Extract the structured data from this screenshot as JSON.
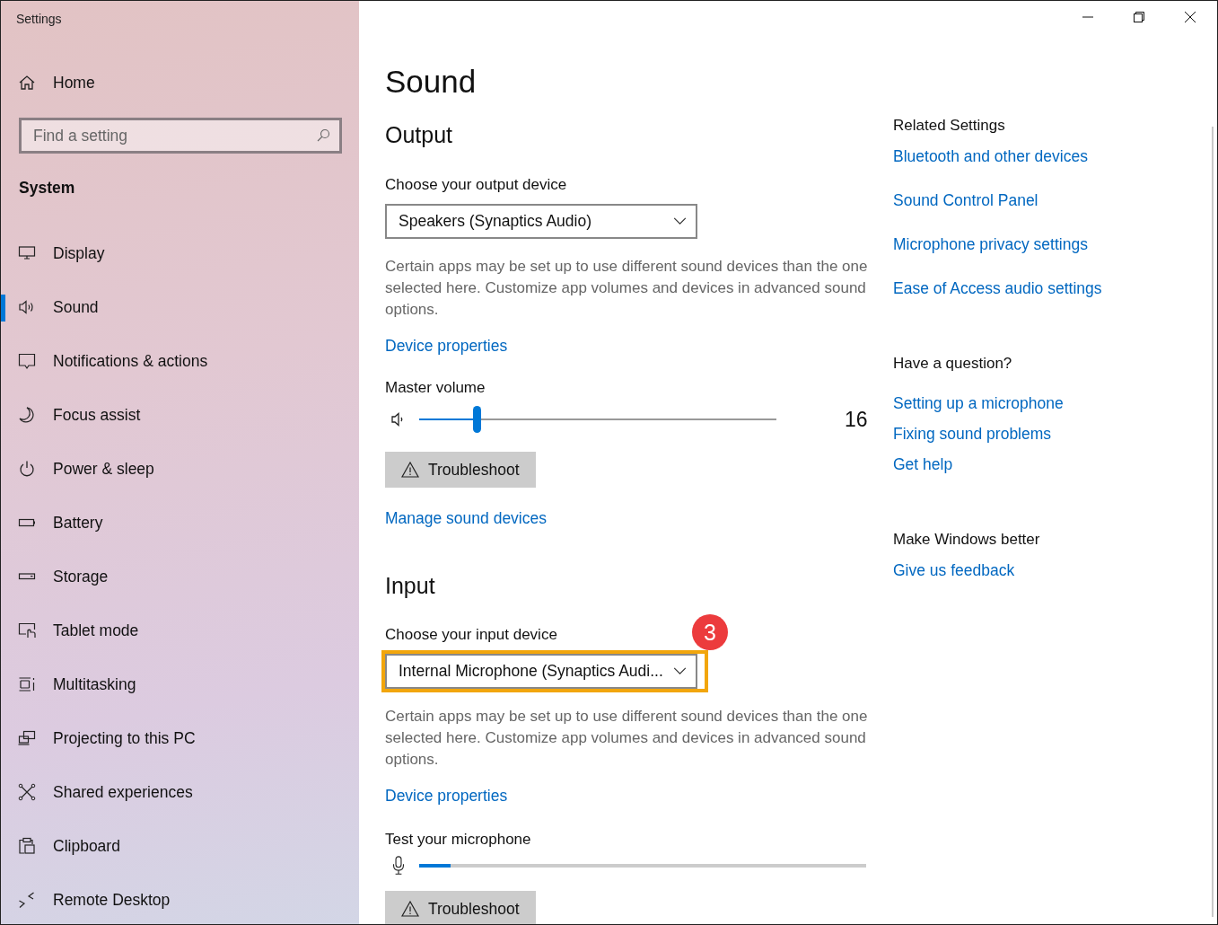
{
  "window": {
    "title": "Settings"
  },
  "sidebar": {
    "home": "Home",
    "search": {
      "placeholder": "Find a setting"
    },
    "section": "System",
    "items": [
      {
        "label": "Display",
        "selected": false
      },
      {
        "label": "Sound",
        "selected": true
      },
      {
        "label": "Notifications & actions",
        "selected": false
      },
      {
        "label": "Focus assist",
        "selected": false
      },
      {
        "label": "Power & sleep",
        "selected": false
      },
      {
        "label": "Battery",
        "selected": false
      },
      {
        "label": "Storage",
        "selected": false
      },
      {
        "label": "Tablet mode",
        "selected": false
      },
      {
        "label": "Multitasking",
        "selected": false
      },
      {
        "label": "Projecting to this PC",
        "selected": false
      },
      {
        "label": "Shared experiences",
        "selected": false
      },
      {
        "label": "Clipboard",
        "selected": false
      },
      {
        "label": "Remote Desktop",
        "selected": false
      }
    ]
  },
  "page": {
    "title": "Sound",
    "output": {
      "heading": "Output",
      "device_label": "Choose your output device",
      "device": "Speakers (Synaptics Audio)",
      "highlighted": false,
      "description": "Certain apps may be set up to use different sound devices than the one selected here. Customize app volumes and devices in advanced sound options.",
      "properties_link": "Device properties",
      "volume_label": "Master volume",
      "volume": {
        "level": 0.16,
        "reading": "16"
      },
      "troubleshoot": "Troubleshoot",
      "manage_link": "Manage sound devices"
    },
    "input": {
      "heading": "Input",
      "device_label": "Choose your input device",
      "device": "Internal Microphone (Synaptics Audi...",
      "highlighted": true,
      "callout": "3",
      "description": "Certain apps may be set up to use different sound devices than the one selected here. Customize app volumes and devices in advanced sound options.",
      "properties_link": "Device properties",
      "test_label": "Test your microphone",
      "meter": {
        "level": 0.07
      },
      "troubleshoot": "Troubleshoot"
    }
  },
  "related": [
    {
      "heading": "Related Settings",
      "links": [
        "Bluetooth and other devices",
        "Sound Control Panel",
        "Microphone privacy settings",
        "Ease of Access audio settings"
      ]
    },
    {
      "heading": "Have a question?",
      "links": [
        "Setting up a microphone",
        "Fixing sound problems",
        "Get help"
      ]
    },
    {
      "heading": "Make Windows better",
      "links": [
        "Give us feedback"
      ]
    }
  ]
}
